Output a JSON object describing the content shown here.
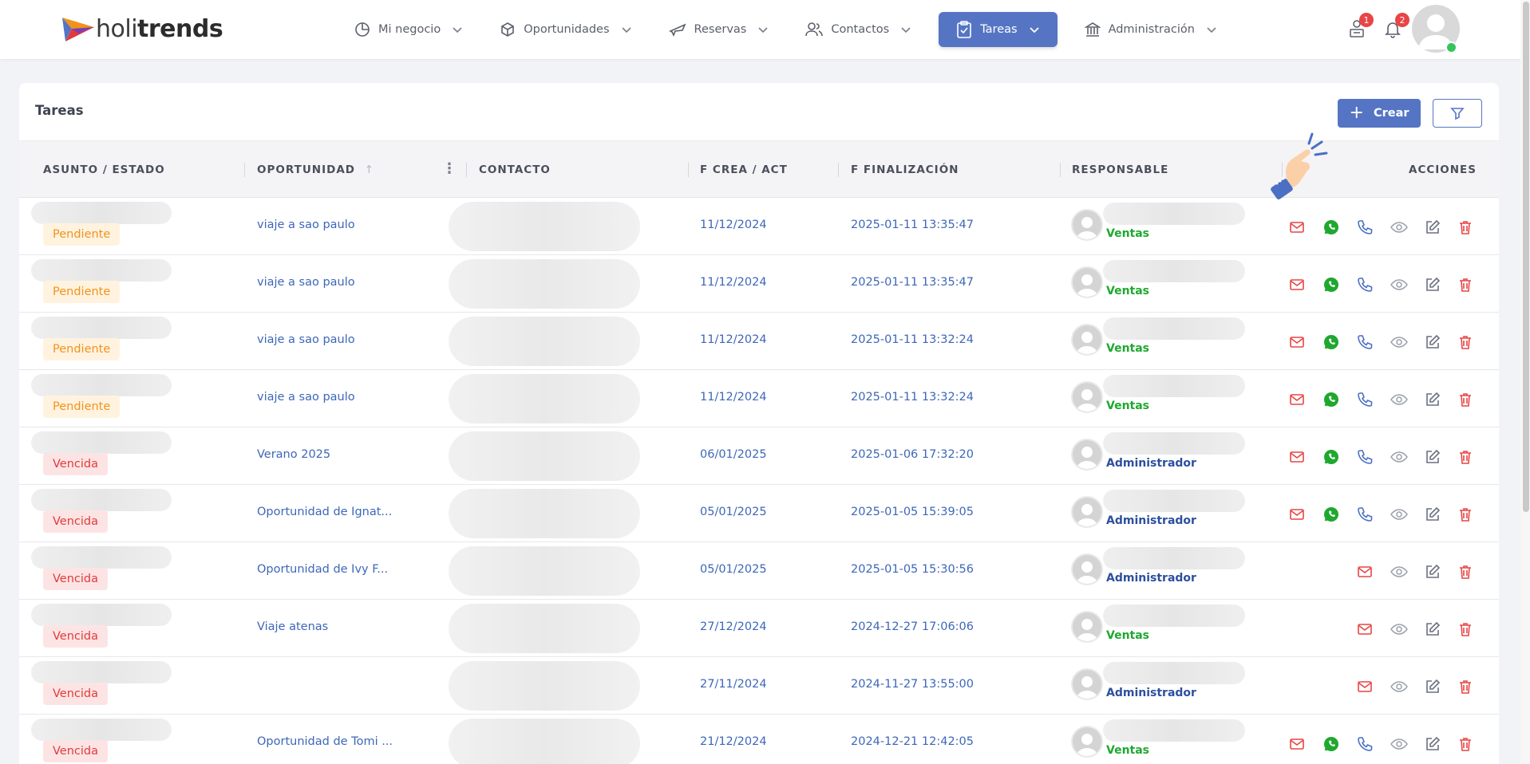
{
  "app": {
    "logo_prefix": "holi",
    "logo_suffix": "trends"
  },
  "nav": {
    "items": [
      {
        "label": "Mi negocio",
        "icon": "pie-chart-icon"
      },
      {
        "label": "Oportunidades",
        "icon": "box-icon"
      },
      {
        "label": "Reservas",
        "icon": "plane-icon"
      },
      {
        "label": "Contactos",
        "icon": "users-icon"
      },
      {
        "label": "Tareas",
        "icon": "clipboard-check-icon",
        "active": true
      },
      {
        "label": "Administración",
        "icon": "bank-icon"
      }
    ],
    "notifications_tasks_count": "1",
    "notifications_bell_count": "2"
  },
  "page": {
    "title": "Tareas",
    "create_label": "Crear"
  },
  "table": {
    "headers": {
      "subject": "ASUNTO / ESTADO",
      "opportunity": "OPORTUNIDAD",
      "contact": "CONTACTO",
      "created": "F CREA / ACT",
      "finished": "F FINALIZACIÓN",
      "owner": "RESPONSABLE",
      "actions": "ACCIONES"
    },
    "rows": [
      {
        "status": "Pendiente",
        "status_type": "pend",
        "opportunity": "viaje a sao paulo",
        "created": "11/12/2024",
        "finished": "2025-01-11 13:35:47",
        "owner_role": "Ventas",
        "owner_color": "green",
        "actions": [
          "mail",
          "whatsapp",
          "phone",
          "view",
          "edit",
          "delete"
        ]
      },
      {
        "status": "Pendiente",
        "status_type": "pend",
        "opportunity": "viaje a sao paulo",
        "created": "11/12/2024",
        "finished": "2025-01-11 13:35:47",
        "owner_role": "Ventas",
        "owner_color": "green",
        "actions": [
          "mail",
          "whatsapp",
          "phone",
          "view",
          "edit",
          "delete"
        ]
      },
      {
        "status": "Pendiente",
        "status_type": "pend",
        "opportunity": "viaje a sao paulo",
        "created": "11/12/2024",
        "finished": "2025-01-11 13:32:24",
        "owner_role": "Ventas",
        "owner_color": "green",
        "actions": [
          "mail",
          "whatsapp",
          "phone",
          "view",
          "edit",
          "delete"
        ]
      },
      {
        "status": "Pendiente",
        "status_type": "pend",
        "opportunity": "viaje a sao paulo",
        "created": "11/12/2024",
        "finished": "2025-01-11 13:32:24",
        "owner_role": "Ventas",
        "owner_color": "green",
        "actions": [
          "mail",
          "whatsapp",
          "phone",
          "view",
          "edit",
          "delete"
        ]
      },
      {
        "status": "Vencida",
        "status_type": "venc",
        "opportunity": "Verano 2025",
        "created": "06/01/2025",
        "finished": "2025-01-06 17:32:20",
        "owner_role": "Administrador",
        "owner_color": "blue",
        "actions": [
          "mail",
          "whatsapp",
          "phone",
          "view",
          "edit",
          "delete"
        ]
      },
      {
        "status": "Vencida",
        "status_type": "venc",
        "opportunity": "Oportunidad de Ignat...",
        "created": "05/01/2025",
        "finished": "2025-01-05 15:39:05",
        "owner_role": "Administrador",
        "owner_color": "blue",
        "actions": [
          "mail",
          "whatsapp",
          "phone",
          "view",
          "edit",
          "delete"
        ]
      },
      {
        "status": "Vencida",
        "status_type": "venc",
        "opportunity": "Oportunidad de Ivy F...",
        "created": "05/01/2025",
        "finished": "2025-01-05 15:30:56",
        "owner_role": "Administrador",
        "owner_color": "blue",
        "actions": [
          "mail",
          "view",
          "edit",
          "delete"
        ]
      },
      {
        "status": "Vencida",
        "status_type": "venc",
        "opportunity": "Viaje atenas",
        "created": "27/12/2024",
        "finished": "2024-12-27 17:06:06",
        "owner_role": "Ventas",
        "owner_color": "green",
        "actions": [
          "mail",
          "view",
          "edit",
          "delete"
        ]
      },
      {
        "status": "Vencida",
        "status_type": "venc",
        "opportunity": "",
        "created": "27/11/2024",
        "finished": "2024-11-27 13:55:00",
        "owner_role": "Administrador",
        "owner_color": "blue",
        "actions": [
          "mail",
          "view",
          "edit",
          "delete"
        ]
      },
      {
        "status": "Vencida",
        "status_type": "venc",
        "opportunity": "Oportunidad de Tomi ...",
        "created": "21/12/2024",
        "finished": "2024-12-21 12:42:05",
        "owner_role": "Ventas",
        "owner_color": "green",
        "actions": [
          "mail",
          "whatsapp",
          "phone",
          "view",
          "edit",
          "delete"
        ]
      }
    ]
  },
  "colors": {
    "accent": "#5575c4",
    "pending": "#f2921b",
    "overdue": "#e23a3a",
    "link": "#3d67b8",
    "whatsapp": "#1fa82f"
  }
}
